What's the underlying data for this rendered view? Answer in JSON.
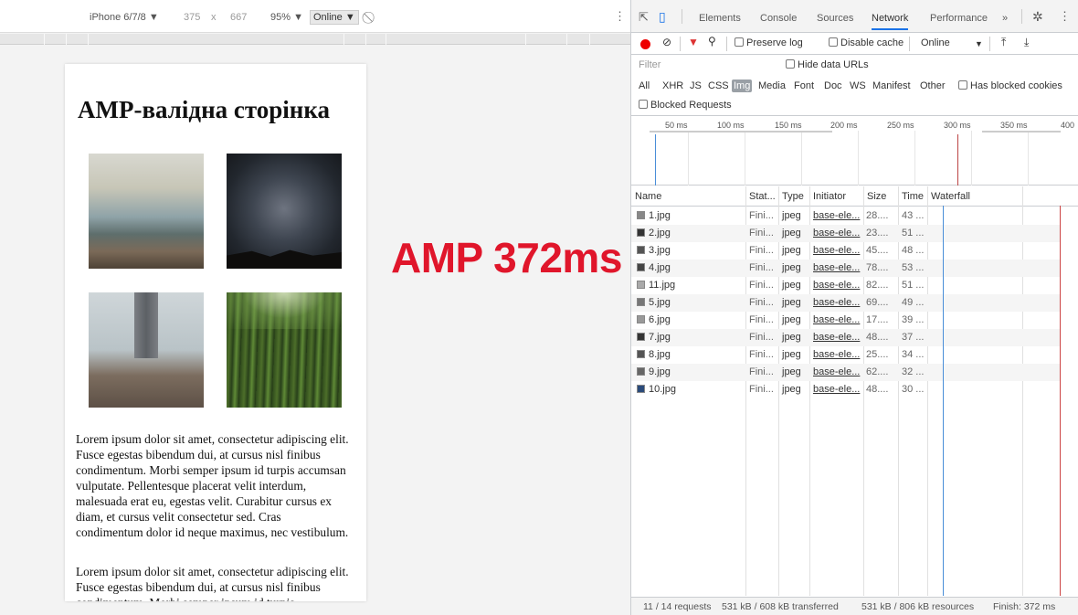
{
  "device_toolbar": {
    "device": "iPhone 6/7/8 ▼",
    "width": "375",
    "times": "x",
    "height": "667",
    "zoom": "95% ▼",
    "throttle": "Online ▼",
    "rotate_icon": "rotate-icon",
    "more_icon": "kebab-menu-icon"
  },
  "page": {
    "title": "AMP-валідна сторінка",
    "images": [
      "mountain-landscape",
      "star-trails-night-sky",
      "legs-standing-on-rocks",
      "bamboo-forest"
    ],
    "paragraphs": [
      "Lorem ipsum dolor sit amet, consectetur adipiscing elit. Fusce egestas bibendum dui, at cursus nisl finibus condimentum. Morbi semper ipsum id turpis accumsan vulputate. Pellentesque placerat velit interdum, malesuada erat eu, egestas velit. Curabitur cursus ex diam, et cursus velit consectetur sed. Cras condimentum dolor id neque maximus, nec vestibulum.",
      "Lorem ipsum dolor sit amet, consectetur adipiscing elit. Fusce egestas bibendum dui, at cursus nisl finibus condimentum. Morbi semper ipsum id turpis"
    ]
  },
  "overlay": {
    "text": "AMP 372ms",
    "color": "#e0162b"
  },
  "devtools": {
    "tabs": [
      "Elements",
      "Console",
      "Sources",
      "Network",
      "Performance",
      "»"
    ],
    "active_tab": "Network",
    "toolbar": {
      "preserve_log": "Preserve log",
      "disable_cache": "Disable cache",
      "throttle": "Online",
      "throttle_arrow": "▼",
      "upload_icon": "import-har-icon",
      "download_icon": "export-har-icon"
    },
    "filter": {
      "placeholder": "Filter",
      "hide_data_urls": "Hide data URLs"
    },
    "types": [
      "All",
      "XHR",
      "JS",
      "CSS",
      "Img",
      "Media",
      "Font",
      "Doc",
      "WS",
      "Manifest",
      "Other"
    ],
    "active_type": "Img",
    "has_blocked_cookies": "Has blocked cookies",
    "blocked_requests": "Blocked Requests",
    "overview_ticks": [
      "50 ms",
      "100 ms",
      "150 ms",
      "200 ms",
      "250 ms",
      "300 ms",
      "350 ms",
      "400"
    ],
    "columns": [
      "Name",
      "Stat...",
      "Type",
      "Initiator",
      "Size",
      "Time",
      "Waterfall"
    ],
    "rows": [
      {
        "name": "1.jpg",
        "status": "Fini...",
        "type": "jpeg",
        "initiator": "base-ele...",
        "size": "28....",
        "time": "43 ..."
      },
      {
        "name": "2.jpg",
        "status": "Fini...",
        "type": "jpeg",
        "initiator": "base-ele...",
        "size": "23....",
        "time": "51 ..."
      },
      {
        "name": "3.jpg",
        "status": "Fini...",
        "type": "jpeg",
        "initiator": "base-ele...",
        "size": "45....",
        "time": "48 ..."
      },
      {
        "name": "4.jpg",
        "status": "Fini...",
        "type": "jpeg",
        "initiator": "base-ele...",
        "size": "78....",
        "time": "53 ..."
      },
      {
        "name": "11.jpg",
        "status": "Fini...",
        "type": "jpeg",
        "initiator": "base-ele...",
        "size": "82....",
        "time": "51 ..."
      },
      {
        "name": "5.jpg",
        "status": "Fini...",
        "type": "jpeg",
        "initiator": "base-ele...",
        "size": "69....",
        "time": "49 ..."
      },
      {
        "name": "6.jpg",
        "status": "Fini...",
        "type": "jpeg",
        "initiator": "base-ele...",
        "size": "17....",
        "time": "39 ..."
      },
      {
        "name": "7.jpg",
        "status": "Fini...",
        "type": "jpeg",
        "initiator": "base-ele...",
        "size": "48....",
        "time": "37 ..."
      },
      {
        "name": "8.jpg",
        "status": "Fini...",
        "type": "jpeg",
        "initiator": "base-ele...",
        "size": "25....",
        "time": "34 ..."
      },
      {
        "name": "9.jpg",
        "status": "Fini...",
        "type": "jpeg",
        "initiator": "base-ele...",
        "size": "62....",
        "time": "32 ..."
      },
      {
        "name": "10.jpg",
        "status": "Fini...",
        "type": "jpeg",
        "initiator": "base-ele...",
        "size": "48....",
        "time": "30 ..."
      }
    ],
    "status_bar": {
      "requests": "11 / 14 requests",
      "transferred": "531 kB / 608 kB transferred",
      "resources": "531 kB / 806 kB resources",
      "finish": "Finish: 372 ms"
    }
  }
}
